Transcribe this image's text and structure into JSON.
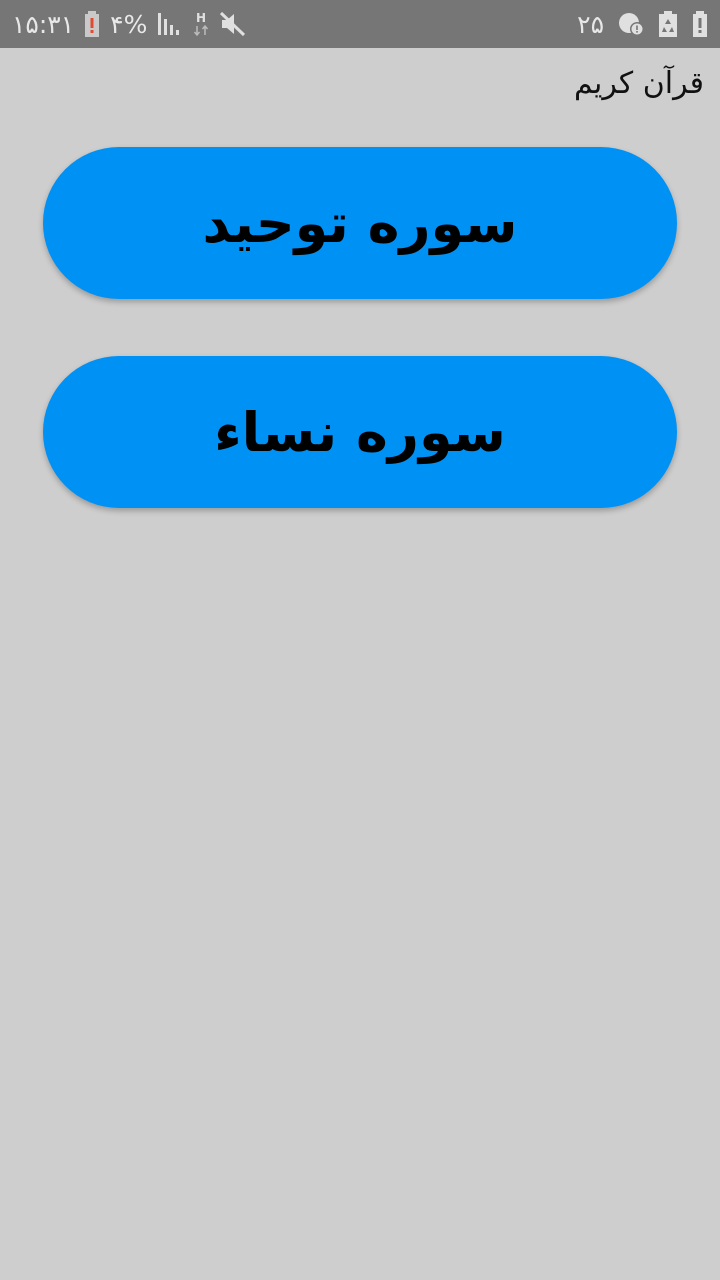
{
  "status_bar": {
    "time": "۱۵:۳۱",
    "battery_percent": "۴%",
    "notification_count": "۲۵",
    "icons": [
      "battery-icon",
      "signal-icon",
      "network-h-icon",
      "mute-icon",
      "chat-alert-icon",
      "recycle-icon",
      "warning-icon"
    ]
  },
  "app": {
    "title": "قرآن کریم"
  },
  "buttons": [
    {
      "label": "سوره توحید"
    },
    {
      "label": "سوره نساء"
    }
  ],
  "colors": {
    "background": "#cecece",
    "status_bar": "#767676",
    "button": "#0091f5"
  }
}
